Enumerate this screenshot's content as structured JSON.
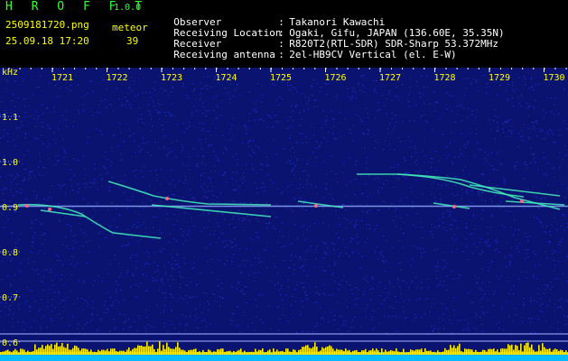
{
  "header": {
    "app_title": "H R O F F T",
    "version": "1.0.0",
    "filename": "2509181720.png",
    "datetime": "25.09.18 17:20",
    "meteor_label": "meteor",
    "meteor_count": "39"
  },
  "info": [
    {
      "key": "Observer",
      "value": "Takanori Kawachi"
    },
    {
      "key": "Receiving Location",
      "value": "Ogaki, Gifu, JAPAN (136.60E, 35.35N)"
    },
    {
      "key": "Receiver",
      "value": "R820T2(RTL-SDR) SDR-Sharp 53.372MHz"
    },
    {
      "key": "Receiving antenna",
      "value": "2el-HB9CV Vertical (el. E-W)"
    }
  ],
  "plot": {
    "unit_label": "kHz",
    "time_ticks": [
      "1721",
      "1722",
      "1723",
      "1724",
      "1725",
      "1726",
      "1727",
      "1728",
      "1729",
      "1730"
    ],
    "freq_ticks": [
      "1.1",
      "1.0",
      "0.9",
      "0.8",
      "0.7",
      "0.6"
    ],
    "colors": {
      "background": "#0a1470",
      "noise": "#2a3cff",
      "trace": "#44eebb",
      "hot": "#ff6688",
      "carrier": "#8fa8ff",
      "tick_text": "#ffff00",
      "level_bars": "#ffee00",
      "level_base": "#00bbff"
    }
  }
}
